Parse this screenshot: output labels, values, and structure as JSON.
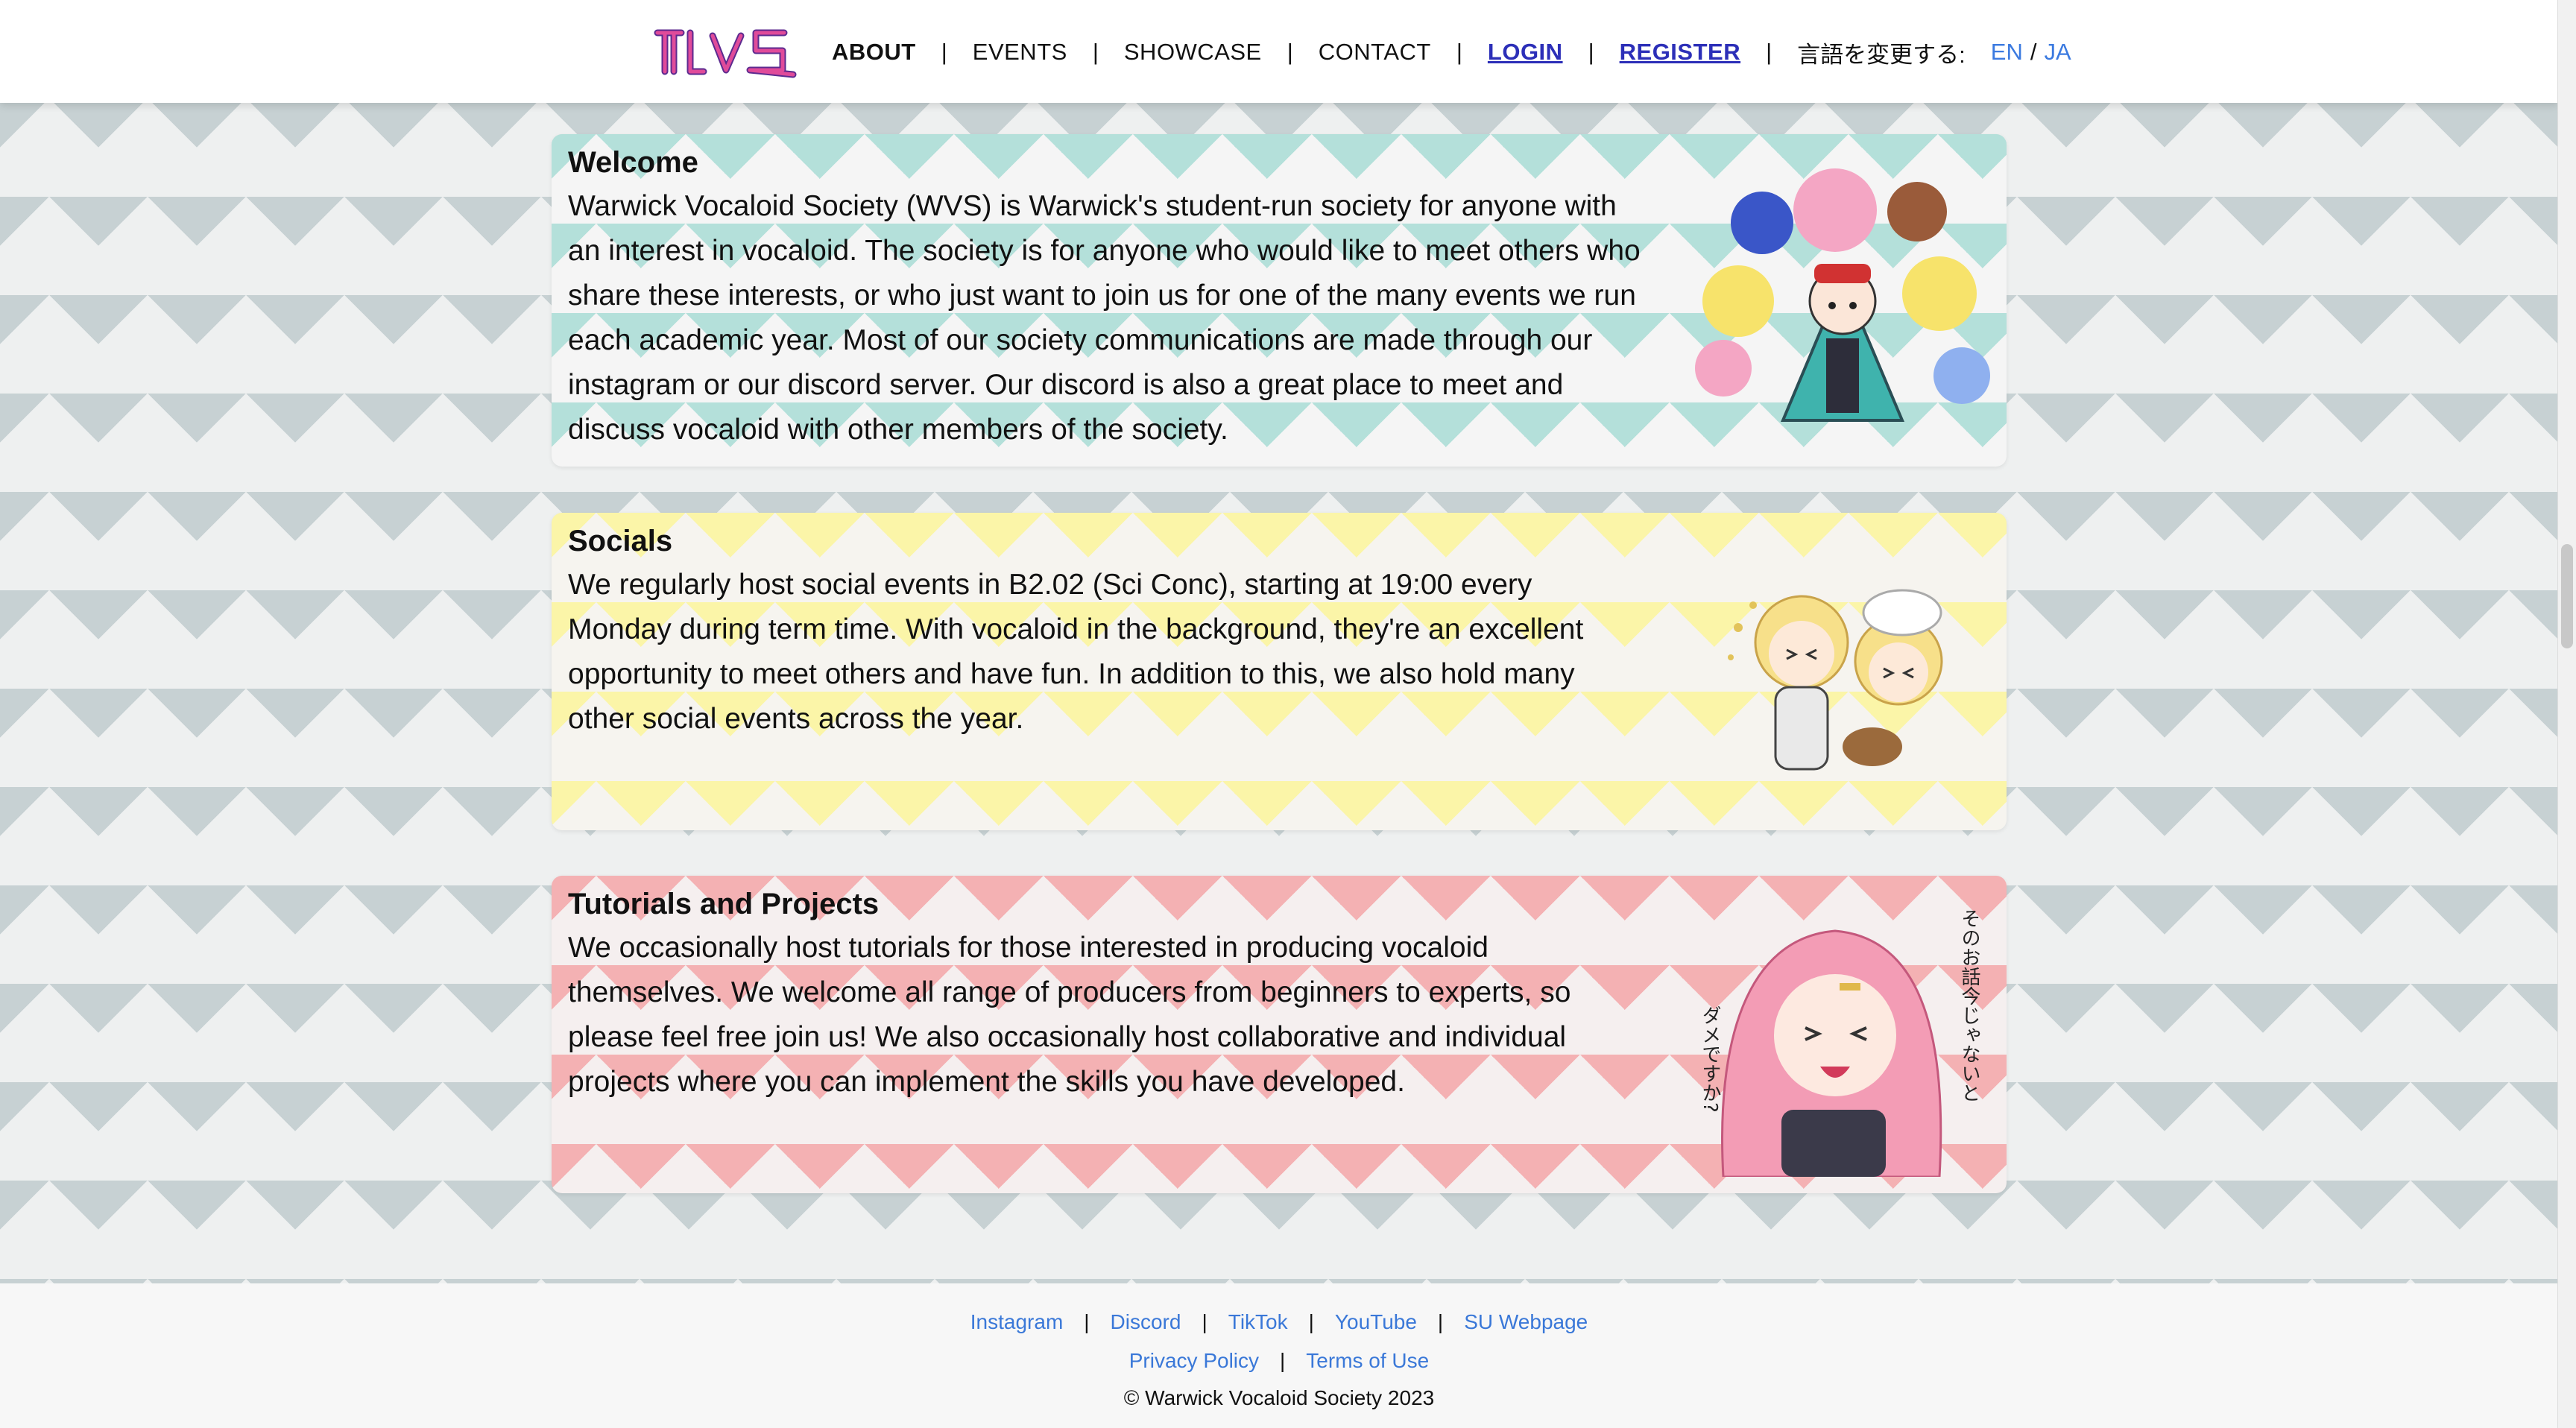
{
  "header": {
    "logo_text": "WVS",
    "nav": [
      {
        "label": "ABOUT"
      },
      {
        "label": "EVENTS"
      },
      {
        "label": "SHOWCASE"
      },
      {
        "label": "CONTACT"
      },
      {
        "label": "LOGIN"
      },
      {
        "label": "REGISTER"
      }
    ],
    "lang_prompt": "言語を変更する:",
    "lang_en": "EN",
    "lang_ja": "JA",
    "separator": "|",
    "lang_divider": "/"
  },
  "sections": [
    {
      "title": "Welcome",
      "body": "Warwick Vocaloid Society (WVS) is Warwick's student-run society for anyone with an interest in vocaloid. The society is for anyone who would like to meet others who share these interests, or who just want to join us for one of the many events we run each academic year. Most of our society communications are made through our instagram or our discord server. Our discord is also a great place to meet and discuss vocaloid with other members of the society."
    },
    {
      "title": "Socials",
      "body": "We regularly host social events in B2.02 (Sci Conc), starting at 19:00 every Monday during term time. With vocaloid in the background, they're an excellent opportunity to meet others and have fun. In addition to this, we also hold many other social events across the year."
    },
    {
      "title": "Tutorials and Projects",
      "body": "We occasionally host tutorials for those interested in producing vocaloid themselves. We welcome all range of producers from beginners to experts, so please feel free join us! We also occasionally host collaborative and individual projects where you can implement the skills you have developed."
    }
  ],
  "art_text": "そのお話 今じゃないと ダメですか?",
  "footer": {
    "links": [
      "Instagram",
      "Discord",
      "TikTok",
      "YouTube",
      "SU Webpage"
    ],
    "legal": [
      "Privacy Policy",
      "Terms of Use"
    ],
    "copyright": "© Warwick Vocaloid Society 2023"
  },
  "colors": {
    "accent_link": "#3a78d8",
    "nav_auth": "#2c2fb8",
    "logo_pink": "#d6378a",
    "logo_purple": "#5c2a8f"
  }
}
